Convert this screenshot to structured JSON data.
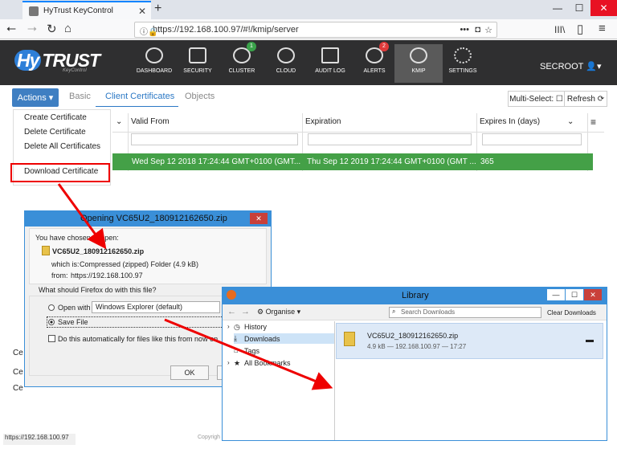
{
  "browser": {
    "tab_title": "HyTrust KeyControl",
    "url_prefix": "https://",
    "url_host": "192.168.100.97",
    "url_path": "/#!/kmip/server",
    "url_dots": "•••",
    "status_url": "https://192.168.100.97"
  },
  "app": {
    "logo": "HyTrust",
    "logo_hy": "Hy",
    "logo_rest": "TRUST",
    "logo_sub": "KeyControl",
    "nav": [
      {
        "label": "DASHBOARD"
      },
      {
        "label": "SECURITY"
      },
      {
        "label": "CLUSTER",
        "badge": "1"
      },
      {
        "label": "CLOUD"
      },
      {
        "label": "AUDIT LOG"
      },
      {
        "label": "ALERTS",
        "badge": "2"
      },
      {
        "label": "KMIP"
      },
      {
        "label": "SETTINGS"
      }
    ],
    "user": "SECROOT"
  },
  "toolbar": {
    "actions_label": "Actions",
    "tabs": [
      "Basic",
      "Client Certificates",
      "Objects"
    ],
    "multiselect": "Multi-Select:",
    "refresh": "Refresh"
  },
  "dropdown": {
    "items": [
      "Create Certificate",
      "Delete Certificate",
      "Delete All Certificates",
      "Download Certificate"
    ]
  },
  "grid": {
    "columns": [
      "Valid From",
      "Expiration",
      "Expires In (days)"
    ],
    "row": {
      "valid_from": "Wed Sep 12 2018 17:24:44 GMT+0100 (GMT...",
      "expiration": "Thu Sep 12 2019 17:24:44 GMT+0100 (GMT ...",
      "expires_in": "365"
    },
    "left_partials": [
      "Ce",
      "Ce",
      "Ce"
    ]
  },
  "copyright": "Copyrigh",
  "ff_dialog": {
    "title": "Opening VC65U2_180912162650.zip",
    "chosen": "You have chosen to open:",
    "filename": "VC65U2_180912162650.zip",
    "which_is_label": "which is:",
    "which_is": "Compressed (zipped) Folder (4.9 kB)",
    "from_label": "from:",
    "from": "https://192.168.100.97",
    "question": "What should Firefox do with this file?",
    "open_with": "Open with",
    "open_with_app": "Windows Explorer (default)",
    "save_file": "Save File",
    "auto": "Do this automatically for files like this from now on.",
    "ok": "OK"
  },
  "library": {
    "title": "Library",
    "organise": "Organise",
    "search_placeholder": "Search Downloads",
    "clear": "Clear Downloads",
    "nav": [
      "History",
      "Downloads",
      "Tags",
      "All Bookmarks"
    ],
    "download": {
      "name": "VC65U2_180912162650.zip",
      "meta": "4.9 kB — 192.168.100.97 — 17:27"
    }
  },
  "colors": {
    "accent": "#3a8fd8",
    "row_green": "#44a047",
    "highlight_red": "#e00000"
  }
}
